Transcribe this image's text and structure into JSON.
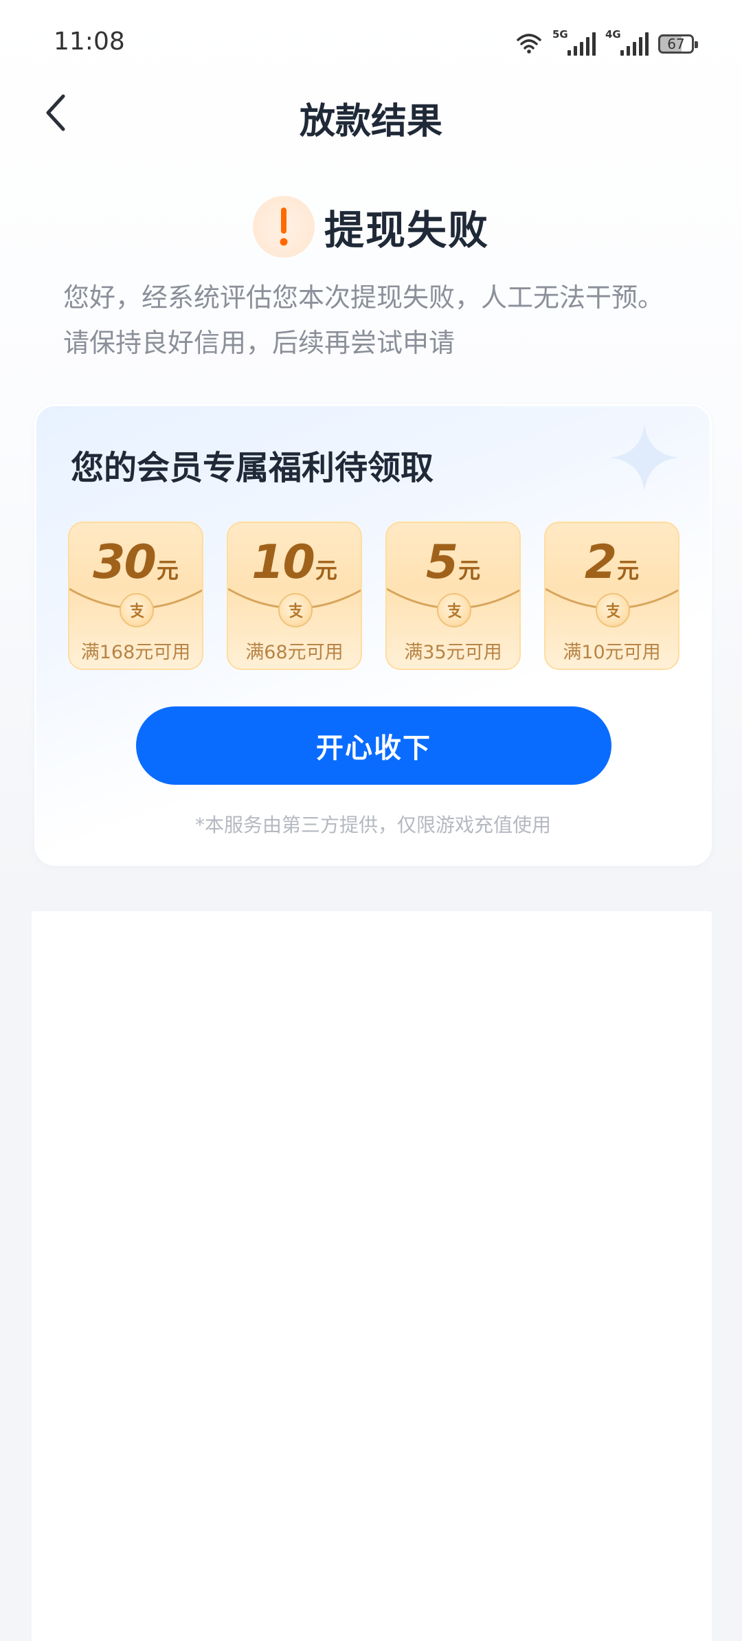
{
  "status_bar": {
    "time": "11:08",
    "network_1": "5G",
    "network_2": "4G",
    "battery": "67"
  },
  "nav": {
    "title": "放款结果",
    "back_icon": "chevron-left-icon"
  },
  "result": {
    "icon": "exclamation-icon",
    "title": "提现失败",
    "description": "您好，经系统评估您本次提现失败，人工无法干预。请保持良好信用，后续再尝试申请"
  },
  "benefits": {
    "title": "您的会员专属福利待领取",
    "coupons": [
      {
        "amount": "30",
        "unit": "元",
        "condition": "满168元可用"
      },
      {
        "amount": "10",
        "unit": "元",
        "condition": "满68元可用"
      },
      {
        "amount": "5",
        "unit": "元",
        "condition": "满35元可用"
      },
      {
        "amount": "2",
        "unit": "元",
        "condition": "满10元可用"
      }
    ],
    "button_label": "开心收下",
    "disclaimer": "*本服务由第三方提供，仅限游戏充值使用"
  },
  "colors": {
    "primary_button": "#0a6cff",
    "warning": "#ff6a00",
    "coupon_text": "#a0621b"
  }
}
